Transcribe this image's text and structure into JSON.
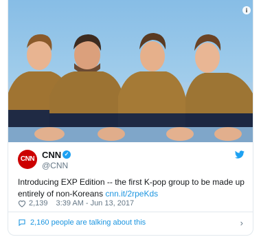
{
  "tweet": {
    "author": {
      "display_name": "CNN",
      "handle": "@CNN",
      "avatar_text": "CNN",
      "verified": true
    },
    "text": "Introducing EXP Edition -- the first K-pop group to be made up entirely of non-Koreans",
    "link": "cnn.it/2rpeKds",
    "like_count": "2,139",
    "time": "3:39 AM",
    "date": "Jun 13, 2017",
    "conversation": "2,160 people are talking about this"
  },
  "colors": {
    "brand_red": "#cc0000",
    "twitter_blue": "#1da1f2",
    "link_blue": "#1b95e0",
    "muted_gray": "#657786"
  },
  "icons": {
    "info": "info-icon",
    "verified": "verified-badge-icon",
    "bird": "twitter-bird-icon",
    "heart": "heart-icon",
    "bubble": "comment-bubble-icon",
    "chevron": "chevron-right-icon"
  }
}
